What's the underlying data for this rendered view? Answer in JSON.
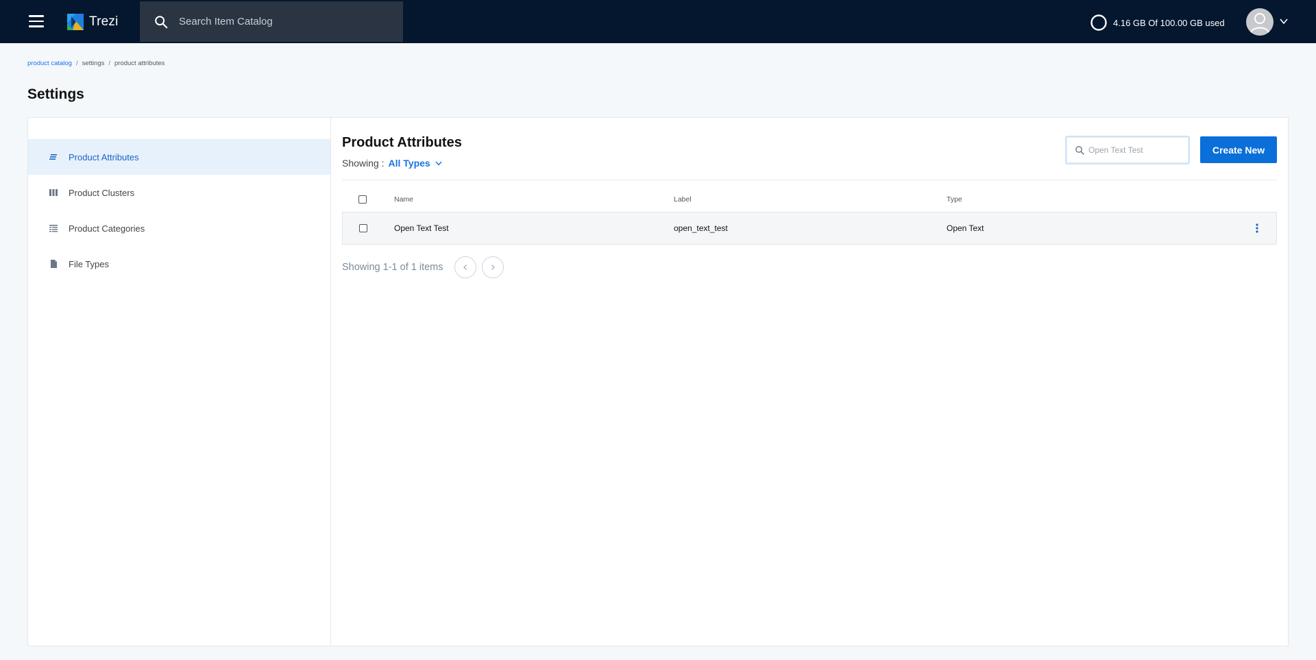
{
  "app": {
    "name": "Trezi",
    "search_placeholder": "Search Item Catalog",
    "storage_text": "4.16 GB Of 100.00 GB used"
  },
  "breadcrumb": [
    {
      "label": "product catalog"
    },
    {
      "label": "settings"
    },
    {
      "label": "product attributes"
    }
  ],
  "page": {
    "title": "Settings"
  },
  "sidebar": {
    "items": [
      {
        "label": "Product Attributes",
        "icon": "attributes-icon",
        "active": true
      },
      {
        "label": "Product Clusters",
        "icon": "clusters-icon",
        "active": false
      },
      {
        "label": "Product Categories",
        "icon": "categories-icon",
        "active": false
      },
      {
        "label": "File Types",
        "icon": "file-icon",
        "active": false
      }
    ]
  },
  "content": {
    "title": "Product Attributes",
    "showing_label": "Showing :",
    "filter_value": "All Types",
    "search_value": "Open Text Test",
    "create_label": "Create New",
    "columns": [
      "Name",
      "Label",
      "Type"
    ],
    "rows": [
      {
        "name": "Open Text Test",
        "label": "open_text_test",
        "type": "Open Text"
      }
    ],
    "pagination_text": "Showing 1-1 of 1 items"
  },
  "colors": {
    "topbar": "#04172e",
    "accent": "#0a6fd8",
    "active_nav_bg": "#e7f1fb"
  }
}
